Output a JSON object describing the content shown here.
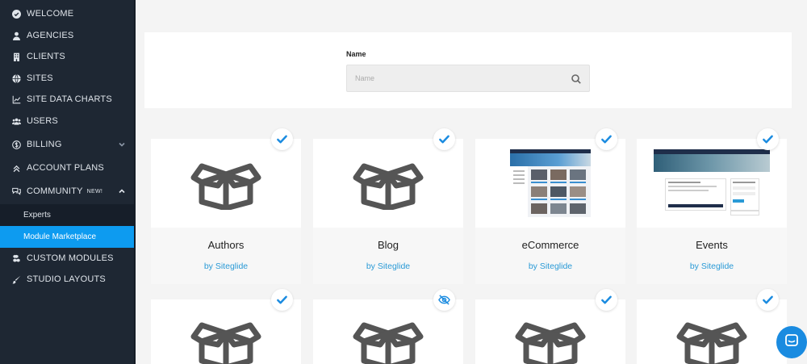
{
  "sidebar": {
    "items": [
      {
        "label": "WELCOME",
        "icon": "check-circle-icon"
      },
      {
        "label": "AGENCIES",
        "icon": "user-icon"
      },
      {
        "label": "CLIENTS",
        "icon": "building-icon"
      },
      {
        "label": "SITES",
        "icon": "globe-icon"
      },
      {
        "label": "SITE DATA CHARTS",
        "icon": "chart-icon"
      },
      {
        "label": "USERS",
        "icon": "users-icon"
      },
      {
        "label": "BILLING",
        "icon": "dollar-icon"
      },
      {
        "label": "ACCOUNT PLANS",
        "icon": "double-chevron-up-icon"
      },
      {
        "label": "COMMUNITY",
        "badge": "NEW!",
        "icon": "comments-icon"
      },
      {
        "label": "CUSTOM MODULES",
        "icon": "cubes-icon"
      },
      {
        "label": "STUDIO LAYOUTS",
        "icon": "brush-icon"
      }
    ],
    "community_sub": [
      {
        "label": "Experts"
      },
      {
        "label": "Module Marketplace"
      }
    ]
  },
  "search": {
    "label": "Name",
    "placeholder": "Name"
  },
  "modules": [
    {
      "title": "Authors",
      "by": "by Siteglide",
      "status": "installed"
    },
    {
      "title": "Blog",
      "by": "by Siteglide",
      "status": "installed"
    },
    {
      "title": "eCommerce",
      "by": "by Siteglide",
      "status": "installed"
    },
    {
      "title": "Events",
      "by": "by Siteglide",
      "status": "installed"
    }
  ],
  "row2_status": [
    "installed",
    "hidden",
    "installed",
    "installed"
  ],
  "colors": {
    "sidebar_bg": "#1e2733",
    "active_item": "#0d9bf0",
    "link": "#2a9ad6",
    "check": "#1a8be0"
  }
}
